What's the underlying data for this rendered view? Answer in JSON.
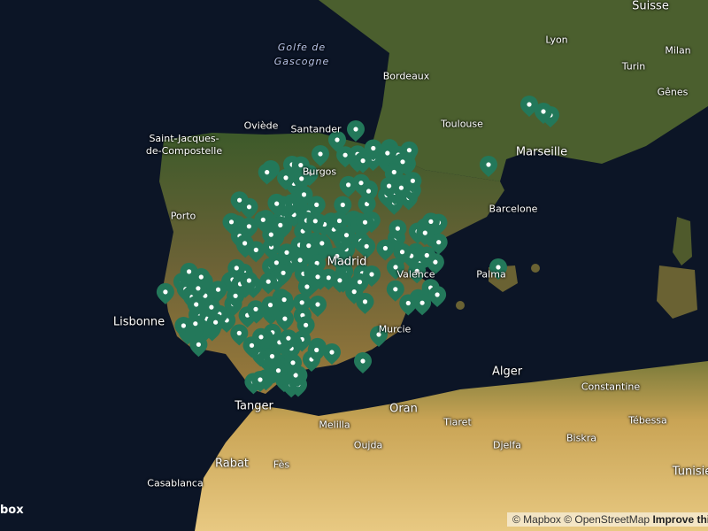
{
  "map": {
    "labels": {
      "sea": [
        "Golfe de",
        "Gascogne"
      ],
      "suisse": "Suisse",
      "lyon": "Lyon",
      "milan": "Milan",
      "turin": "Turin",
      "genes": "Gênes",
      "bordeaux": "Bordeaux",
      "toulouse": "Toulouse",
      "marseille": "Marseille",
      "barcelone": "Barcelone",
      "oviede": "Oviède",
      "santander": "Santander",
      "burgos": "Burgos",
      "santiago": "Saint-Jacques-\nde-Compostelle",
      "porto": "Porto",
      "madrid": "Madrid",
      "valence": "Valence",
      "lisbonne": "Lisbonne",
      "murcie": "Murcie",
      "palma": "Palma",
      "alger": "Alger",
      "constantine": "Constantine",
      "tanger": "Tanger",
      "oran": "Oran",
      "melilla": "Melilla",
      "tiaret": "Tiaret",
      "djelfa": "Djelfa",
      "biskra": "Biskra",
      "tebessa": "Tébessa",
      "oujda": "Oujda",
      "rabat": "Rabat",
      "fes": "Fès",
      "casablanca": "Casablanca",
      "tunisie": "Tunisie"
    },
    "marker_color": "#23785a"
  },
  "logo": "box",
  "attribution": {
    "mapbox": "© Mapbox",
    "osm": "© OpenStreetMap",
    "improve": "Improve this map"
  }
}
